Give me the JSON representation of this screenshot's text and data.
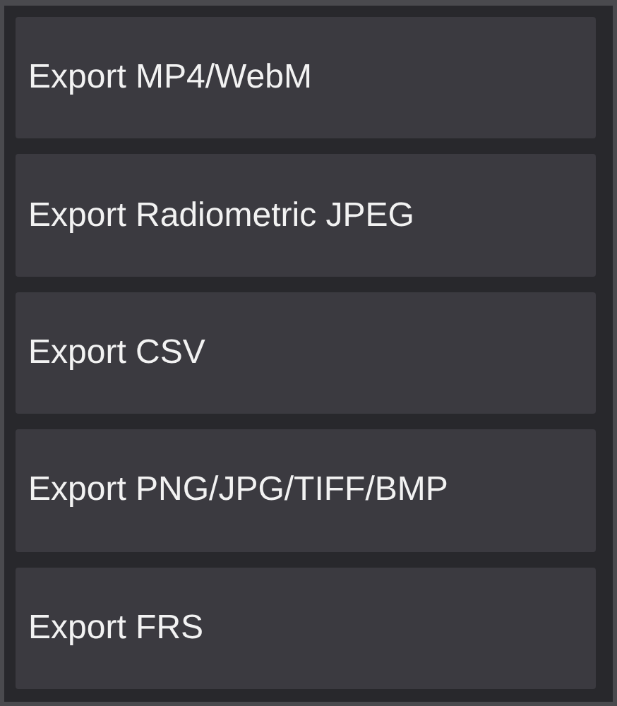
{
  "menu": {
    "items": [
      {
        "label": "Export MP4/WebM"
      },
      {
        "label": "Export Radiometric JPEG"
      },
      {
        "label": "Export CSV"
      },
      {
        "label": "Export PNG/JPG/TIFF/BMP"
      },
      {
        "label": "Export FRS"
      }
    ]
  }
}
